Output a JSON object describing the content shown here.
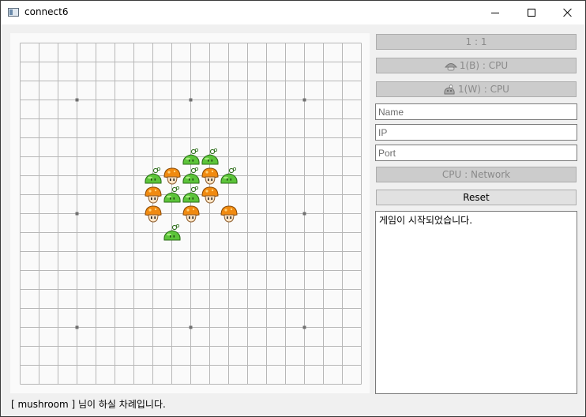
{
  "window": {
    "title": "connect6"
  },
  "titlebar": {
    "icon": "app-window-icon",
    "controls": [
      "minimize-icon",
      "maximize-icon",
      "close-icon"
    ]
  },
  "board": {
    "size": 19,
    "star_points": [
      [
        3,
        3
      ],
      [
        9,
        3
      ],
      [
        15,
        3
      ],
      [
        3,
        9
      ],
      [
        9,
        9
      ],
      [
        15,
        9
      ],
      [
        3,
        15
      ],
      [
        9,
        15
      ],
      [
        15,
        15
      ]
    ],
    "stones": [
      {
        "col": 9,
        "row": 6,
        "kind": "slime"
      },
      {
        "col": 10,
        "row": 6,
        "kind": "slime"
      },
      {
        "col": 7,
        "row": 7,
        "kind": "slime"
      },
      {
        "col": 8,
        "row": 7,
        "kind": "mushroom"
      },
      {
        "col": 9,
        "row": 7,
        "kind": "slime"
      },
      {
        "col": 10,
        "row": 7,
        "kind": "mushroom"
      },
      {
        "col": 11,
        "row": 7,
        "kind": "slime"
      },
      {
        "col": 7,
        "row": 8,
        "kind": "mushroom"
      },
      {
        "col": 8,
        "row": 8,
        "kind": "slime"
      },
      {
        "col": 9,
        "row": 8,
        "kind": "slime"
      },
      {
        "col": 10,
        "row": 8,
        "kind": "mushroom"
      },
      {
        "col": 7,
        "row": 9,
        "kind": "mushroom"
      },
      {
        "col": 9,
        "row": 9,
        "kind": "mushroom"
      },
      {
        "col": 11,
        "row": 9,
        "kind": "mushroom"
      },
      {
        "col": 8,
        "row": 10,
        "kind": "slime"
      }
    ],
    "colors": {
      "grid": "#b7b7b7",
      "star": "#707070",
      "mushroom_cap": "#f08a10",
      "slime": "#5cc43a"
    }
  },
  "sidebar": {
    "score_label": "1 : 1",
    "player_black_label": "1(B) : CPU",
    "player_black_icon": "mushroom-icon",
    "player_white_label": "1(W) : CPU",
    "player_white_icon": "slime-icon",
    "name_placeholder": "Name",
    "ip_placeholder": "IP",
    "port_placeholder": "Port",
    "mode_label": "CPU : Network",
    "reset_label": "Reset",
    "log_text": "게임이 시작되었습니다."
  },
  "status": {
    "text": "[ mushroom ] 님이 하실 차례입니다."
  }
}
